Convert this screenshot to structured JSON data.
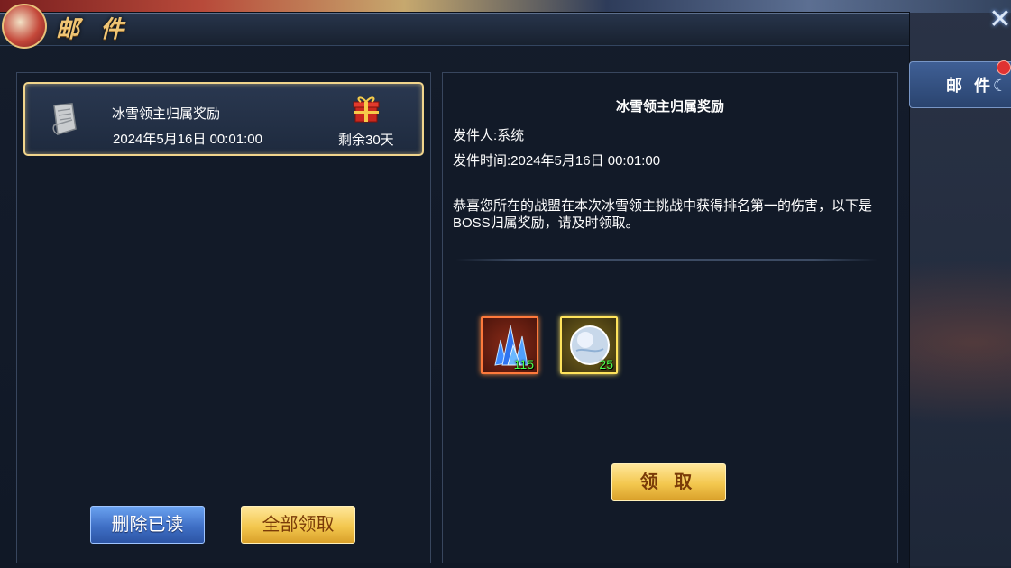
{
  "window": {
    "title": "邮 件",
    "close_icon": "close-x-icon"
  },
  "side_tab": {
    "label": "邮 件"
  },
  "mail_list": {
    "items": [
      {
        "subject": "冰雪领主归属奖励",
        "date": "2024年5月16日 00:01:00",
        "remaining": "剩余30天",
        "icon": "scroll-icon",
        "attachment_icon": "gift-box-icon"
      }
    ]
  },
  "list_actions": {
    "delete_read_label": "删除已读",
    "claim_all_label": "全部领取"
  },
  "detail": {
    "title": "冰雪领主归属奖励",
    "sender": "发件人:系统",
    "sent_time": "发件时间:2024年5月16日 00:01:00",
    "body": "恭喜您所在的战盟在本次冰雪领主挑战中获得排名第一的伤害，以下是BOSS归属奖励，请及时领取。",
    "rewards": [
      {
        "icon": "blue-crystal-icon",
        "count": "115",
        "rarity_color": "#ff7a3c"
      },
      {
        "icon": "ice-orb-icon",
        "count": "25",
        "rarity_color": "#ffe45c"
      }
    ],
    "claim_label": "领 取"
  },
  "colors": {
    "title_gold": "#f0c574",
    "selection_border": "#f1d58c",
    "count_green": "#4dff4d"
  }
}
